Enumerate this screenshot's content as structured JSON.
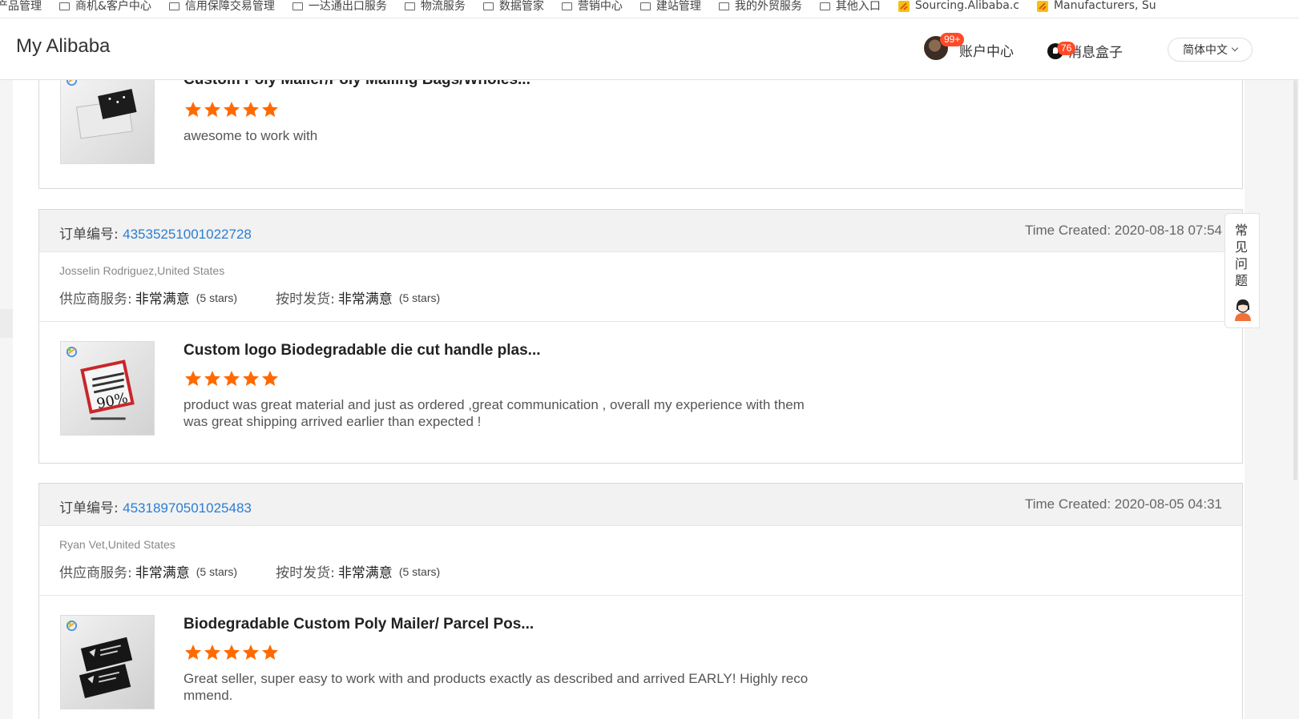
{
  "bookmarks": {
    "items": [
      {
        "label": "产品管理",
        "icon": "folder-icon"
      },
      {
        "label": "商机&客户中心",
        "icon": "folder-icon"
      },
      {
        "label": "信用保障交易管理",
        "icon": "folder-icon"
      },
      {
        "label": "一达通出口服务",
        "icon": "folder-icon"
      },
      {
        "label": "物流服务",
        "icon": "folder-icon"
      },
      {
        "label": "数据管家",
        "icon": "folder-icon"
      },
      {
        "label": "营销中心",
        "icon": "folder-icon"
      },
      {
        "label": "建站管理",
        "icon": "folder-icon"
      },
      {
        "label": "我的外贸服务",
        "icon": "folder-icon"
      },
      {
        "label": "其他入口",
        "icon": "folder-icon"
      },
      {
        "label": "Sourcing.Alibaba.c",
        "icon": "alibaba-favicon-icon"
      },
      {
        "label": "Manufacturers, Su",
        "icon": "alibaba-favicon-icon"
      }
    ]
  },
  "header": {
    "brand": "My Alibaba",
    "account_badge": "99+",
    "account_label": "账户中心",
    "message_badge": "76",
    "message_label": "消息盒子",
    "language": "简体中文"
  },
  "colors": {
    "accent_link": "#2a7ed3",
    "star": "#ff6a00",
    "badge": "#ff4a28"
  },
  "labels": {
    "order_prefix": "订单编号:",
    "supplier_service": "供应商服务:",
    "on_time_delivery": "按时发货:"
  },
  "first_card": {
    "product_title": "Custom Poly Mailer/Poly Mailing Bags/Wholes...",
    "rating": 5,
    "review": "awesome to work with"
  },
  "orders": [
    {
      "order_number": "43535251001022728",
      "time_created": "Time Created: 2020-08-18 07:54",
      "buyer": "Josselin Rodriguez,United States",
      "supplier_rating": "非常满意",
      "supplier_stars": "(5 stars)",
      "delivery_rating": "非常满意",
      "delivery_stars": "(5 stars)",
      "product_title": "Custom logo Biodegradable die cut handle plas...",
      "rating": 5,
      "review": "product was great material and just as ordered ,great communication , overall my experience with them was great shipping arrived earlier than expected !"
    },
    {
      "order_number": "45318970501025483",
      "time_created": "Time Created: 2020-08-05 04:31",
      "buyer": "Ryan Vet,United States",
      "supplier_rating": "非常满意",
      "supplier_stars": "(5 stars)",
      "delivery_rating": "非常满意",
      "delivery_stars": "(5 stars)",
      "product_title": "Biodegradable Custom Poly Mailer/ Parcel Pos...",
      "rating": 5,
      "review": "Great seller, super easy to work with and products exactly as described and arrived EARLY! Highly recommend."
    }
  ],
  "faq": {
    "label": "常见问题"
  }
}
